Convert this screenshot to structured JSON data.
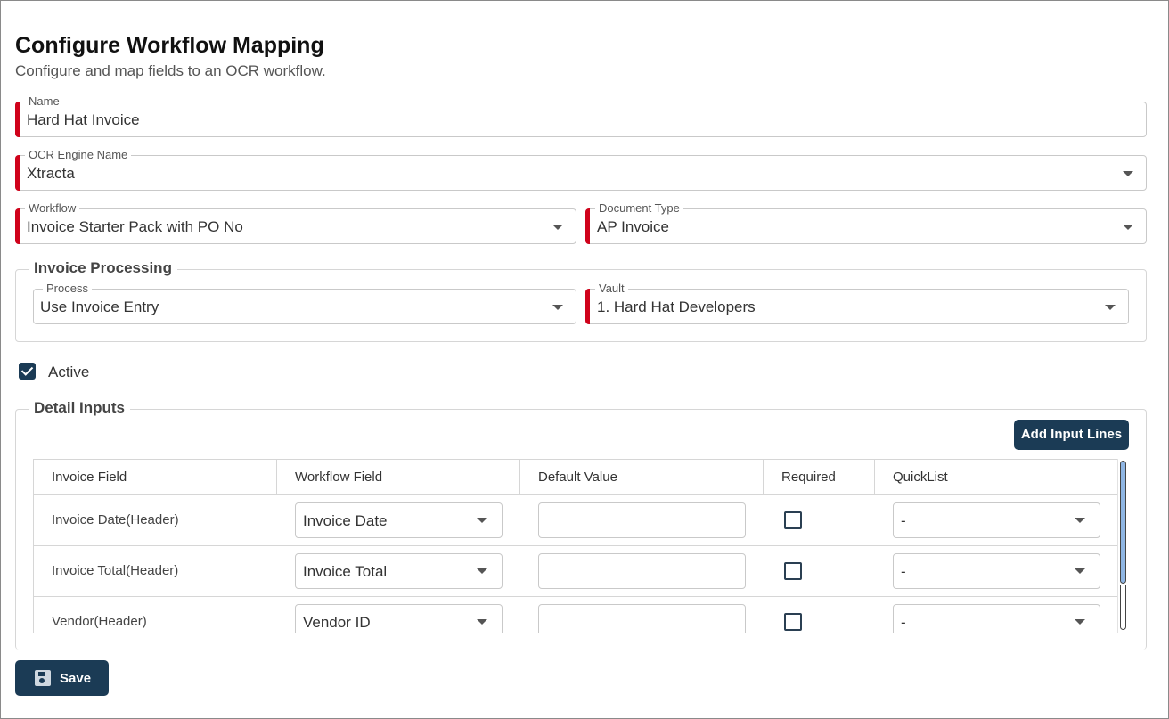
{
  "header": {
    "title": "Configure Workflow Mapping",
    "subtitle": "Configure and map fields to an OCR workflow."
  },
  "form": {
    "name": {
      "label": "Name",
      "value": "Hard Hat Invoice"
    },
    "ocr_engine": {
      "label": "OCR Engine Name",
      "value": "Xtracta"
    },
    "workflow": {
      "label": "Workflow",
      "value": "Invoice Starter Pack with PO No"
    },
    "document_type": {
      "label": "Document Type",
      "value": "AP Invoice"
    }
  },
  "invoice_processing": {
    "title": "Invoice Processing",
    "process": {
      "label": "Process",
      "value": "Use Invoice Entry"
    },
    "vault": {
      "label": "Vault",
      "value": "1. Hard Hat Developers"
    }
  },
  "active": {
    "label": "Active",
    "checked": true
  },
  "detail_inputs": {
    "title": "Detail Inputs",
    "add_button": "Add Input Lines",
    "columns": [
      "Invoice Field",
      "Workflow Field",
      "Default Value",
      "Required",
      "QuickList"
    ],
    "rows": [
      {
        "invoice_field": "Invoice Date(Header)",
        "workflow_field": "Invoice Date",
        "default_value": "",
        "required": false,
        "quicklist": "-"
      },
      {
        "invoice_field": "Invoice Total(Header)",
        "workflow_field": "Invoice Total",
        "default_value": "",
        "required": false,
        "quicklist": "-"
      },
      {
        "invoice_field": "Vendor(Header)",
        "workflow_field": "Vendor ID",
        "default_value": "",
        "required": false,
        "quicklist": "-"
      }
    ]
  },
  "footer": {
    "save_label": "Save"
  },
  "colors": {
    "primary": "#1b3b55",
    "required_marker": "#d0021b"
  }
}
